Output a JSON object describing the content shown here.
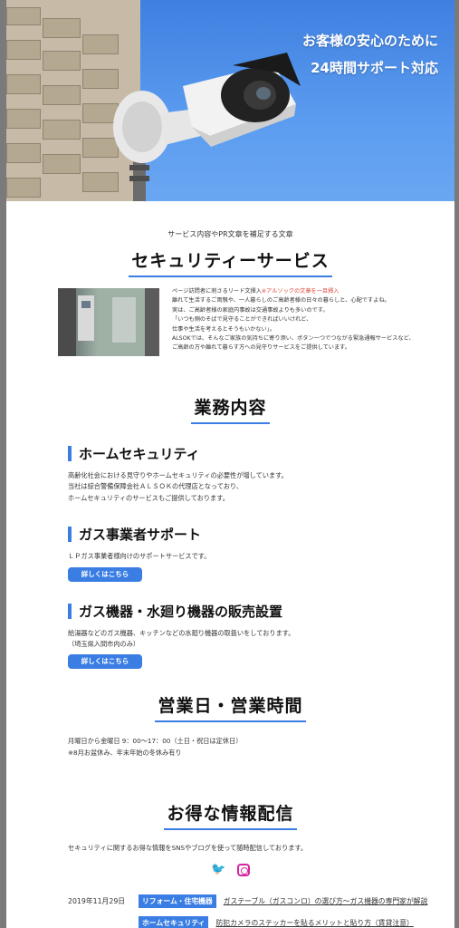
{
  "hero": {
    "line1": "お客様の安心のために",
    "line2": "24時間サポート対応"
  },
  "intro": {
    "small_lead": "サービス内容やPR文章を補足する文章",
    "title": "セキュリティーサービス",
    "text_line1_prefix": "ページ訪問者に刺さるリード文挿入",
    "text_line1_red": "※アルソックの文章を一旦挿入",
    "text_line2": "離れて生活するご両親や、一人暮らしのご高齢者様の日々の暮らしと、心配ですよね。",
    "text_line3": "実は、ご高齢者様の家庭内事故は交通事故よりも多いのです。",
    "text_line4": "「いつも側のそばで見守ることができればいいけれど、",
    "text_line5": "仕事や生活を考えるとそうもいかない」。",
    "text_line6": "ALSOKでは、そんなご家族の気持ちに寄り添い、ボタン一つでつながる緊急通報サービスなど、",
    "text_line7": "ご高齢の方や離れて暮らす方への見守りサービスをご提供しています。"
  },
  "business": {
    "title": "業務内容",
    "services": [
      {
        "name": "ホームセキュリティ",
        "lines": [
          "高齢化社会における見守りやホームセキュリティの必要性が増しています。",
          "当社は綜合警備保障会社ＡＬＳＯＫの代理店となっており、",
          "ホームセキュリティのサービスもご提供しております。"
        ]
      },
      {
        "name": "ガス事業者サポート",
        "lines": [
          "ＬＰガス事業者様向けのサポートサービスです。"
        ],
        "button": "詳しくはこちら"
      },
      {
        "name": "ガス機器・水廻り機器の販売設置",
        "lines": [
          "給湯器などのガス機器、キッチンなどの水廻り機器の取扱いをしております。",
          "（埼玉県入間市内のみ）"
        ],
        "button": "詳しくはこちら"
      }
    ]
  },
  "hours": {
    "title": "営業日・営業時間",
    "line1": "月曜日から金曜日 9：00〜17：00（土日・祝日は定休日）",
    "line2": "※8月お盆休み、年末年始の冬休み有り"
  },
  "info": {
    "title": "お得な情報配信",
    "text": "セキュリティに関するお得な情報をSNSやブログを使って随時配信しております。",
    "icons": [
      "twitter-icon",
      "instagram-icon"
    ]
  },
  "news": [
    {
      "date": "2019年11月29日",
      "category": "リフォーム・住宅機器",
      "title": "ガステーブル（ガスコンロ）の選び方〜ガス機器の専門家が解説"
    },
    {
      "date": "",
      "category": "ホームセキュリティ",
      "title": "防犯カメラのステッカーを貼るメリットと貼り方（賃貸注意）"
    }
  ],
  "colors": {
    "accent": "#3a7ee4",
    "highlight": "#e0463a",
    "hero_sky": "#4f8fe8"
  }
}
